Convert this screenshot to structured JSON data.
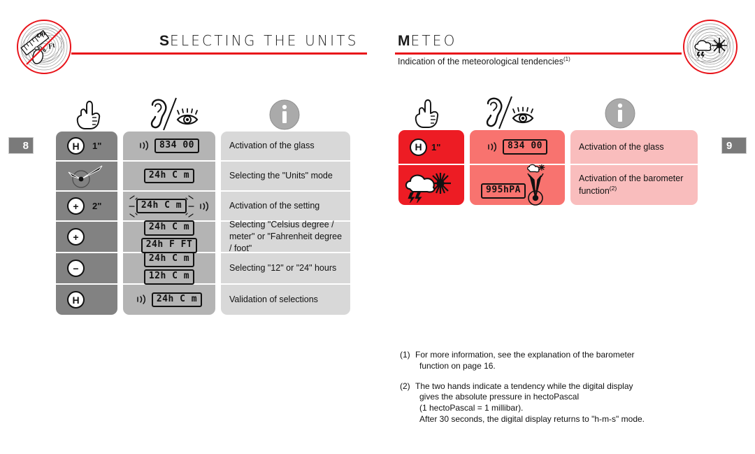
{
  "document": {
    "left_page_number": "8",
    "right_page_number": "9"
  },
  "colors": {
    "accent_red": "#e8131a",
    "cell_red_dark": "#ed1c24",
    "cell_red_mid": "#f8736f",
    "cell_red_light": "#f9bdbd",
    "cell_gray_dark": "#828282",
    "cell_gray_mid": "#b4b4b4",
    "cell_gray_light": "#d8d8d8",
    "text": "#111111"
  },
  "left_section": {
    "title_initial": "S",
    "title_rest": "ELECTING THE UNITS",
    "emblem_icon": "ruler-cm-ft-icon",
    "pictograms": [
      {
        "name": "hand-press-icon",
        "label": "press"
      },
      {
        "name": "ear-eye-icon",
        "label": "hear / see"
      },
      {
        "name": "info-icon",
        "label": "information"
      }
    ],
    "rows": [
      {
        "button": "H",
        "duration": "1\"",
        "button_icon": "h-button-icon",
        "sound": true,
        "lcd_main": "834",
        "lcd_secondary": "00",
        "lcd_blink": false,
        "lcd_lines": [],
        "description": "Activation of the glass"
      },
      {
        "button": "",
        "duration": "",
        "button_icon": "watch-hands-icon",
        "sound": false,
        "lcd_main": "",
        "lcd_secondary": "",
        "lcd_blink": false,
        "lcd_lines": [
          "24h C m"
        ],
        "description": "Selecting the  \"Units\" mode"
      },
      {
        "button": "+",
        "duration": "2\"",
        "button_icon": "plus-button-icon",
        "sound": true,
        "lcd_main": "",
        "lcd_secondary": "",
        "lcd_blink": true,
        "lcd_lines": [
          "24h C m"
        ],
        "description": "Activation of the setting"
      },
      {
        "button": "+",
        "duration": "",
        "button_icon": "plus-button-icon",
        "sound": false,
        "lcd_main": "",
        "lcd_secondary": "",
        "lcd_blink": false,
        "lcd_lines": [
          "24h C m",
          "24h F FT"
        ],
        "description": "Selecting \"Celsius degree / meter\" or \"Fahrenheit degree / foot\""
      },
      {
        "button": "−",
        "duration": "",
        "button_icon": "minus-button-icon",
        "sound": false,
        "lcd_main": "",
        "lcd_secondary": "",
        "lcd_blink": false,
        "lcd_lines": [
          "24h C m",
          "12h C m"
        ],
        "description": "Selecting \"12\" or \"24\" hours"
      },
      {
        "button": "H",
        "duration": "",
        "button_icon": "h-button-icon",
        "sound": true,
        "lcd_main": "",
        "lcd_secondary": "",
        "lcd_blink": false,
        "lcd_lines": [
          "24h C m"
        ],
        "description": "Validation of selections"
      }
    ]
  },
  "right_section": {
    "title_initial": "M",
    "title_rest": "ETEO",
    "subtitle": "Indication of the meteorological tendencies",
    "subtitle_note": "(1)",
    "emblem_icon": "cloud-sun-icon",
    "pictograms": [
      {
        "name": "hand-press-icon",
        "label": "press"
      },
      {
        "name": "ear-eye-icon",
        "label": "hear / see"
      },
      {
        "name": "info-icon",
        "label": "information"
      }
    ],
    "rows": [
      {
        "button": "H",
        "duration": "1\"",
        "button_icon": "h-button-icon",
        "sound": true,
        "lcd_main": "834",
        "lcd_secondary": "00",
        "description": "Activation of the glass",
        "description_note": ""
      },
      {
        "button": "",
        "duration": "",
        "button_icon": "cloud-storm-sun-icon",
        "sound": false,
        "lcd_main": "995hPA",
        "lcd_secondary": "",
        "description": "Activation of the barometer function",
        "description_note": "(2)"
      }
    ],
    "footnotes": [
      {
        "marker": "(1)",
        "lines": [
          "For more information, see the explanation of the barometer",
          "function on page 16."
        ]
      },
      {
        "marker": "(2)",
        "lines": [
          "The two hands indicate a tendency while the digital display",
          "gives the absolute pressure in hectoPascal",
          "(1 hectoPascal = 1 millibar).",
          "After 30 seconds, the digital display returns to \"h-m-s\" mode."
        ]
      }
    ]
  }
}
